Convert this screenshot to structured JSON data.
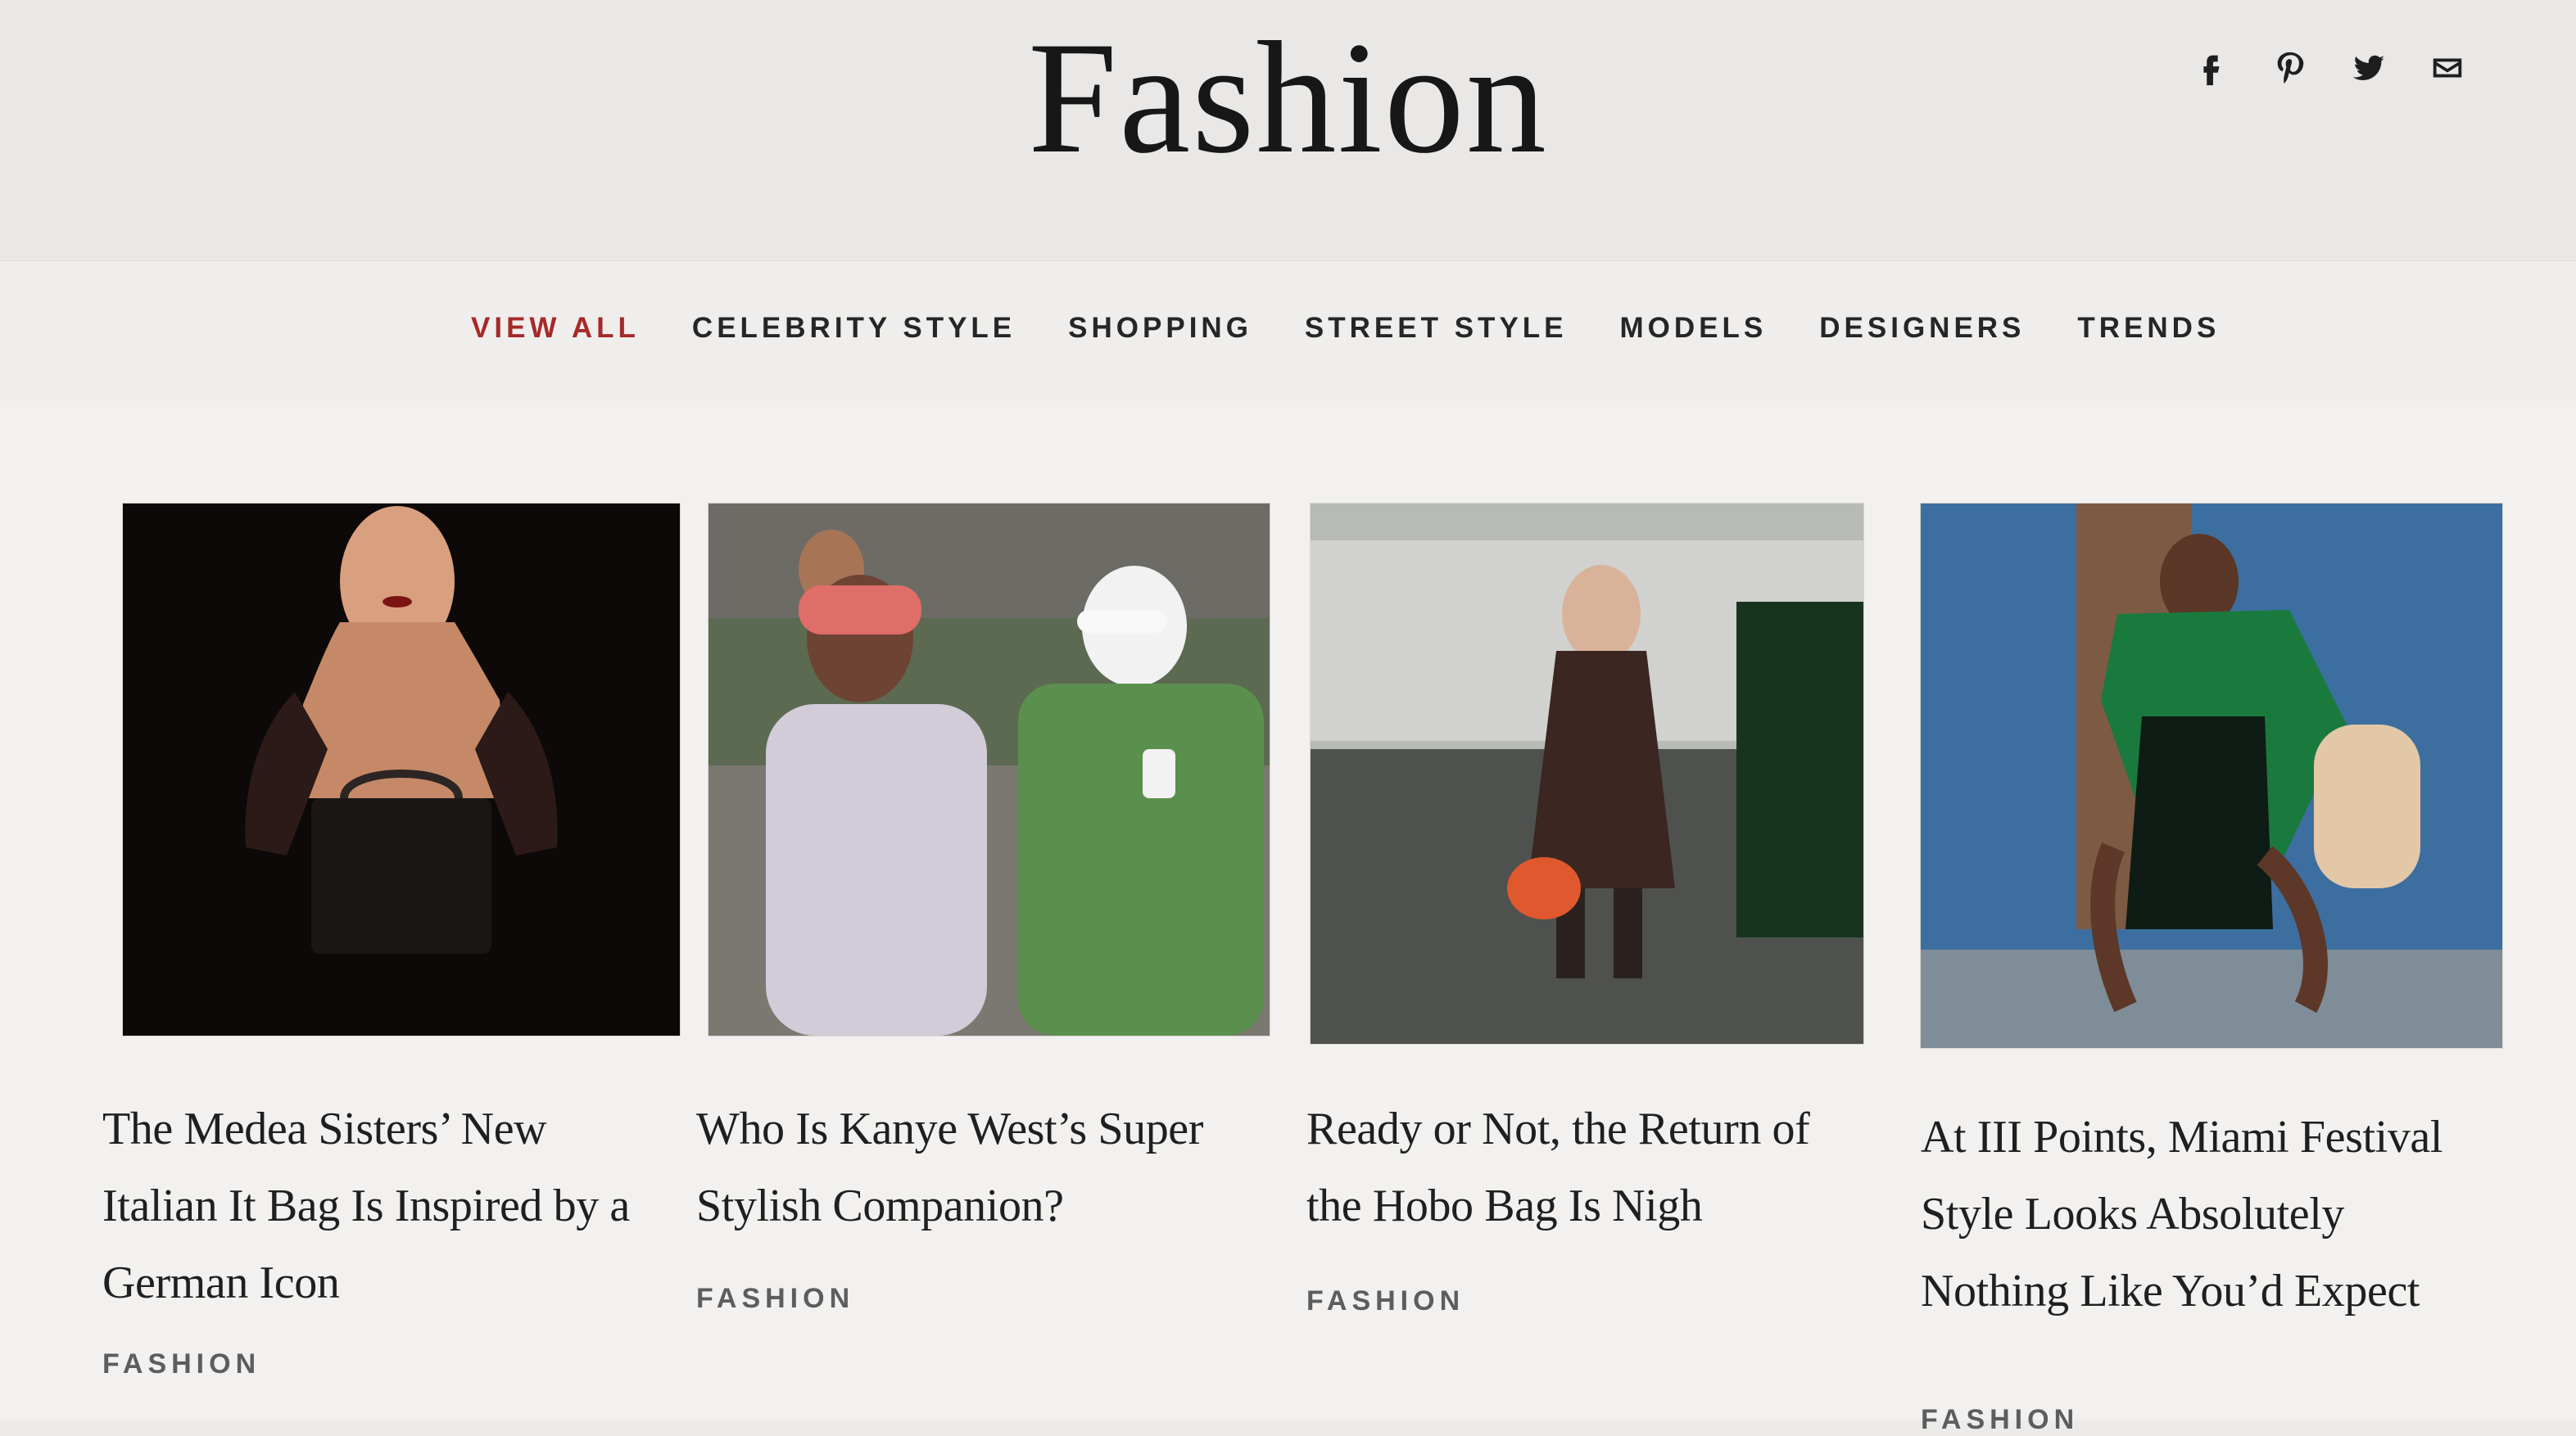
{
  "header": {
    "title": "Fashion"
  },
  "social": [
    {
      "label": "f",
      "icon": "facebook-icon"
    },
    {
      "label": "P",
      "icon": "pinterest-icon"
    },
    {
      "label": "Twitter",
      "icon": "twitter-icon"
    },
    {
      "label": "Email",
      "icon": "mail-icon"
    }
  ],
  "nav": {
    "items": [
      {
        "label": "VIEW ALL",
        "active": true
      },
      {
        "label": "CELEBRITY STYLE",
        "active": false
      },
      {
        "label": "SHOPPING",
        "active": false
      },
      {
        "label": "STREET STYLE",
        "active": false
      },
      {
        "label": "MODELS",
        "active": false
      },
      {
        "label": "DESIGNERS",
        "active": false
      },
      {
        "label": "TRENDS",
        "active": false
      }
    ]
  },
  "cards": [
    {
      "title": "The Medea Sisters’ New Italian It Bag Is Inspired by a German Icon",
      "tag": "FASHION"
    },
    {
      "title": "Who Is Kanye West’s Super Stylish Companion?",
      "tag": "FASHION"
    },
    {
      "title": "Ready or Not, the Return of the Hobo Bag Is Nigh",
      "tag": "FASHION"
    },
    {
      "title": "At III Points, Miami Festival Style Looks Absolutely Nothing Like You’d Expect",
      "tag": "FASHION"
    }
  ],
  "colors": {
    "accent": "#a62a2a",
    "text": "#1b1b1b",
    "background": "#f2f1ef"
  }
}
